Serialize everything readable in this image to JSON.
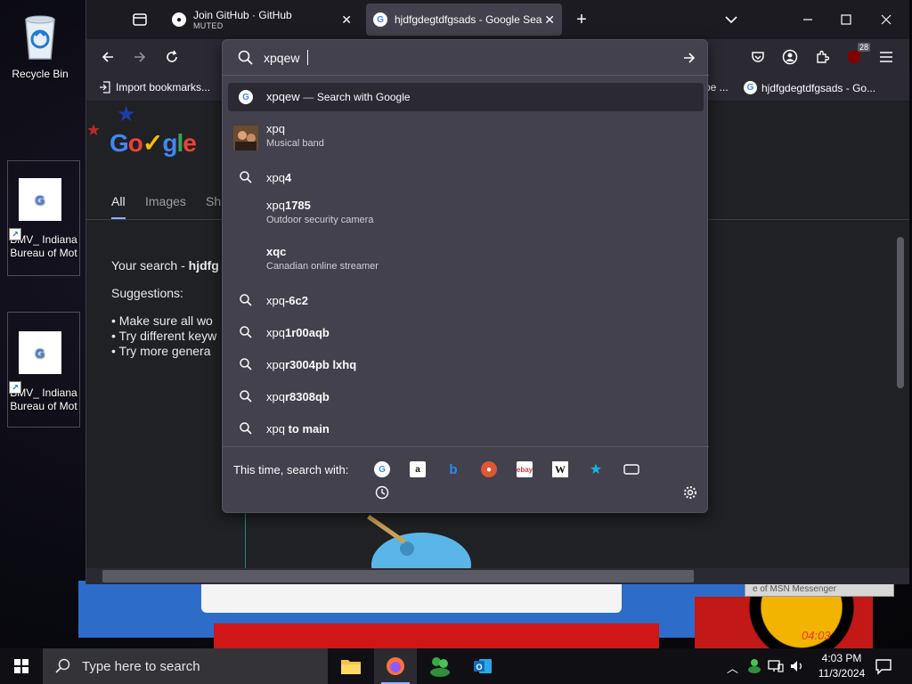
{
  "desktop": {
    "icons": [
      {
        "label": "Recycle Bin"
      },
      {
        "label": "BMV_ Indiana Bureau of Mot"
      },
      {
        "label": "BMV_ Indiana Bureau of Mot"
      }
    ],
    "msn_text": "e of MSN Messenger",
    "art_time": "04:03"
  },
  "browser": {
    "tabs": [
      {
        "title": "Join GitHub · GitHub",
        "sub": "MUTED"
      },
      {
        "title": "hjdfgdegtdfgsads - Google Sea"
      }
    ],
    "toolbar_badge": "28",
    "bookmarks": {
      "import": "Import bookmarks...",
      "partial": "pe ...",
      "last": "hjdfgdegtdfgsads - Go..."
    }
  },
  "page": {
    "tabs": [
      "All",
      "Images",
      "Sh"
    ],
    "your_search_prefix": "Your search - ",
    "your_search_query": "hjdfg",
    "suggestions_title": "Suggestions:",
    "suggestions": [
      "Make sure all wo",
      "Try different keyw",
      "Try more genera"
    ]
  },
  "urlbar": {
    "value": "xpqew",
    "first": {
      "query": "xpqew",
      "dash": "—",
      "action": "Search with Google"
    },
    "suggestions": [
      {
        "type": "rich",
        "pre": "xpq",
        "bold": "",
        "sub": "Musical band"
      },
      {
        "type": "search",
        "pre": "xpq",
        "bold": "4"
      },
      {
        "type": "rich",
        "pre": "xpq",
        "bold": "1785",
        "sub": "Outdoor security camera"
      },
      {
        "type": "rich",
        "pre": "",
        "bold": "xqc",
        "sub": "Canadian online streamer"
      },
      {
        "type": "search",
        "pre": "xpq",
        "bold": "-6c2"
      },
      {
        "type": "search",
        "pre": "xpq",
        "bold": "1r00aqb"
      },
      {
        "type": "search",
        "pre": "xpq",
        "bold": "r3004pb lxhq"
      },
      {
        "type": "search",
        "pre": "xpq",
        "bold": "r8308qb"
      },
      {
        "type": "search",
        "pre": "xpq ",
        "bold": "to main"
      }
    ],
    "engine_label": "This time, search with:",
    "engines": [
      "google",
      "amazon",
      "bing",
      "duckduckgo",
      "ebay",
      "wikipedia",
      "bookmarks",
      "tabs"
    ]
  },
  "taskbar": {
    "search_placeholder": "Type here to search",
    "time": "4:03 PM",
    "date": "11/3/2024"
  },
  "colors": {
    "accent": "#8ab4f8",
    "popup_bg": "#42414d",
    "toolbar_bg": "#2b2a33",
    "frame_bg": "#1c1b22"
  }
}
